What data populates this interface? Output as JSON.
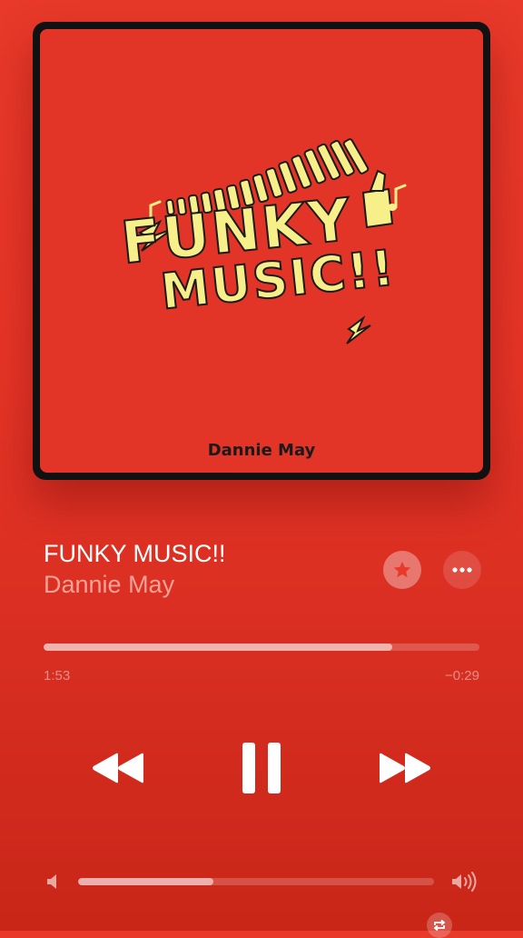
{
  "album_art": {
    "title_line1": "FUNKY",
    "title_line2": "MUSIC!!",
    "artist": "Dannie May",
    "background_color": "#e23528",
    "text_color": "#f7f08a"
  },
  "now_playing": {
    "title": "FUNKY MUSIC!!",
    "artist": "Dannie May"
  },
  "actions": {
    "favorite_icon": "star-icon",
    "more_icon": "ellipsis-icon"
  },
  "progress": {
    "elapsed": "1:53",
    "remaining": "−0:29",
    "fraction": 0.8
  },
  "controls": {
    "rewind_icon": "rewind-icon",
    "pause_icon": "pause-icon",
    "forward_icon": "fast-forward-icon"
  },
  "volume": {
    "fraction": 0.38,
    "low_icon": "speaker-low-icon",
    "high_icon": "speaker-high-icon"
  },
  "colors": {
    "accent": "#e8392a",
    "text_primary": "#ffffff"
  }
}
